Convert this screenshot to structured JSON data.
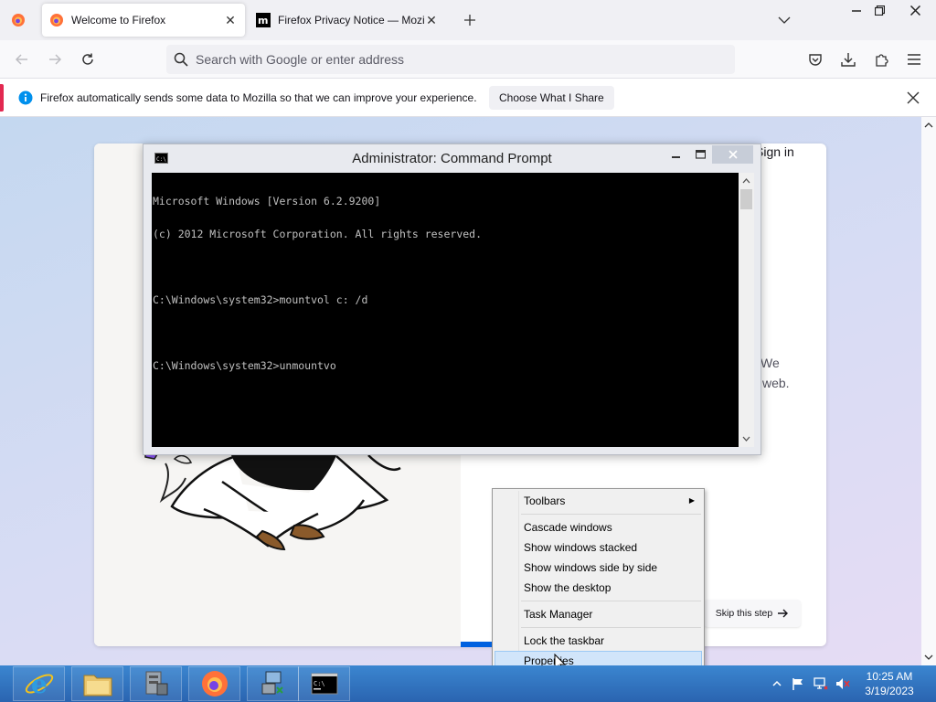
{
  "browser": {
    "tabs": [
      {
        "title": "Welcome to Firefox",
        "active": true
      },
      {
        "title": "Firefox Privacy Notice — Mozilla",
        "active": false
      }
    ],
    "urlbar": {
      "placeholder": "Search with Google or enter address",
      "value": ""
    },
    "notification": {
      "message": "Firefox automatically sends some data to Mozilla so that we can improve your experience.",
      "button_label": "Choose What I Share"
    }
  },
  "page": {
    "signin_label": "Sign in",
    "partial_text_line1": "We",
    "partial_text_line2": "web.",
    "skip_label": "Skip this step"
  },
  "cmd_window": {
    "title": "Administrator: Command Prompt",
    "lines": [
      "Microsoft Windows [Version 6.2.9200]",
      "(c) 2012 Microsoft Corporation. All rights reserved.",
      "",
      "C:\\Windows\\system32>mountvol c: /d",
      "",
      "C:\\Windows\\system32>unmountvo"
    ]
  },
  "context_menu": {
    "items": [
      {
        "label": "Toolbars",
        "submenu": true
      },
      {
        "label": "Cascade windows"
      },
      {
        "label": "Show windows stacked"
      },
      {
        "label": "Show windows side by side"
      },
      {
        "label": "Show the desktop"
      },
      {
        "label": "Task Manager"
      },
      {
        "label": "Lock the taskbar"
      },
      {
        "label": "Properties",
        "highlighted": true
      }
    ]
  },
  "taskbar": {
    "apps": [
      "internet-explorer",
      "file-explorer",
      "server-manager",
      "firefox",
      "network-config",
      "command-prompt"
    ],
    "clock": {
      "time": "10:25 AM",
      "date": "3/19/2023"
    }
  },
  "colors": {
    "accent_blue": "#0061e0",
    "notification_accent": "#e22850",
    "taskbar": "#2d6fb7",
    "menu_highlight": "#d1e5fa"
  }
}
